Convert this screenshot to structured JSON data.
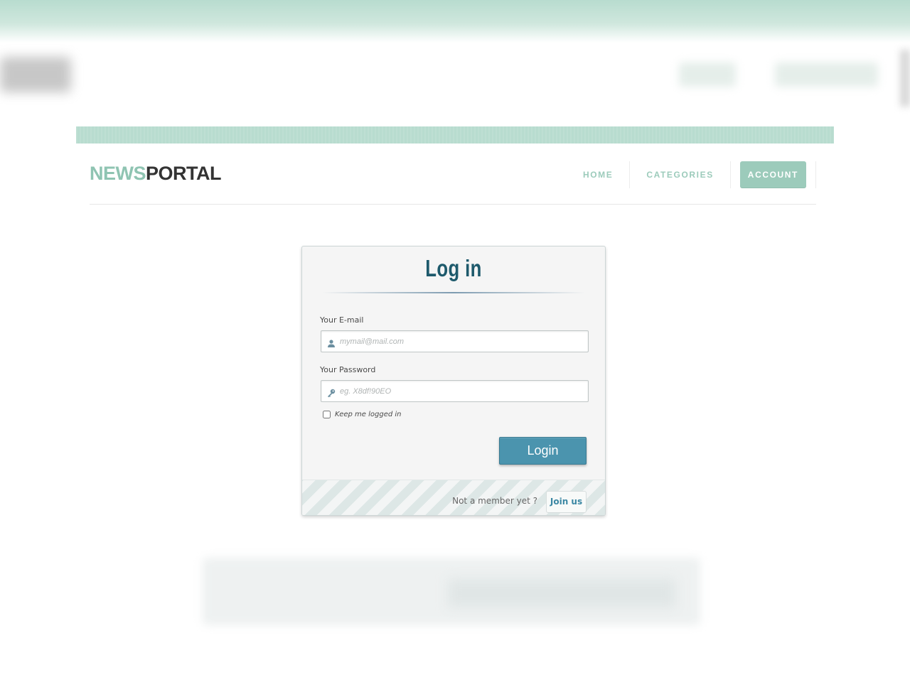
{
  "brand": {
    "part1": "NEWS",
    "part2": "PORTAL"
  },
  "nav": {
    "items": [
      {
        "label": "HOME",
        "active": false
      },
      {
        "label": "CATEGORIES",
        "active": false
      },
      {
        "label": "ACCOUNT",
        "active": true
      }
    ]
  },
  "login": {
    "title": "Log in",
    "email_label": "Your E-mail",
    "email_placeholder": "mymail@mail.com",
    "email_value": "",
    "password_label": "Your Password",
    "password_placeholder": "eg. X8df!90EO",
    "password_value": "",
    "keep_label": "Keep me logged in",
    "keep_checked": false,
    "submit_label": "Login",
    "footer_text": "Not a member yet ?",
    "join_label": "Join us"
  },
  "colors": {
    "accent": "#9ccbbb",
    "title": "#1e5a6c",
    "button": "#4b94ae",
    "link": "#3b87a3"
  },
  "icons": {
    "email": "user-icon",
    "password": "key-icon"
  }
}
